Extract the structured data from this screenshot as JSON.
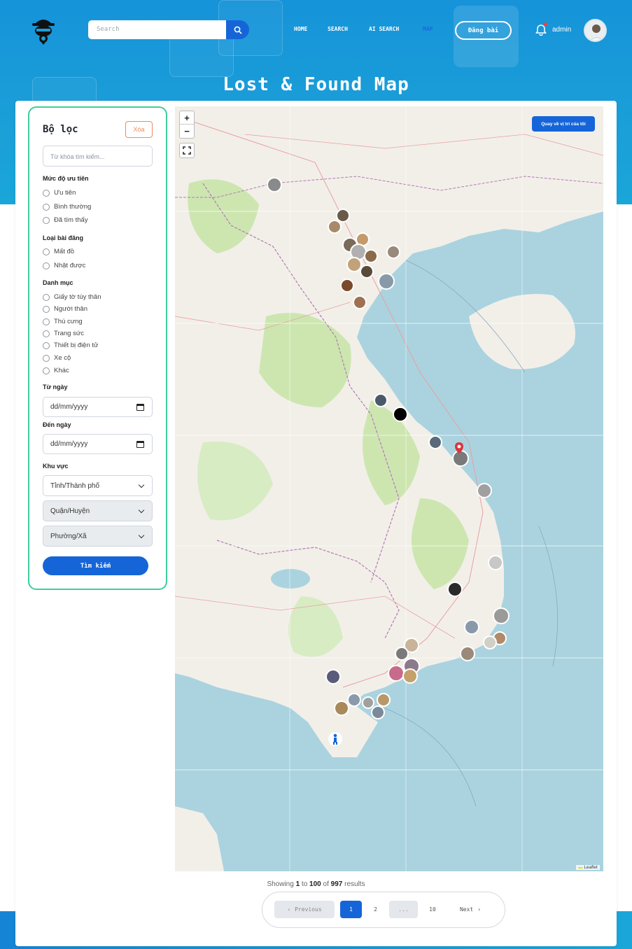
{
  "header": {
    "search_placeholder": "Search",
    "nav": [
      "HOME",
      "SEARCH",
      "AI SEARCH",
      "MAP"
    ],
    "active_nav": "MAP",
    "post_button": "Đăng bài",
    "user_name": "admin",
    "notification_dot_color": "#ff3b3b"
  },
  "page_title": "Lost & Found Map",
  "filter": {
    "title": "Bộ lọc",
    "clear_label": "Xóa",
    "keyword_placeholder": "Từ khóa tìm kiếm...",
    "priority": {
      "label": "Mức độ ưu tiên",
      "options": [
        "Ưu tiên",
        "Bình thường",
        "Đã tìm thấy"
      ]
    },
    "post_type": {
      "label": "Loại bài đăng",
      "options": [
        "Mất đồ",
        "Nhặt được"
      ]
    },
    "category": {
      "label": "Danh mục",
      "options": [
        "Giấy tờ tùy thân",
        "Người thân",
        "Thú cưng",
        "Trang sức",
        "Thiết bị điện tử",
        "Xe cộ",
        "Khác"
      ]
    },
    "from_date": {
      "label": "Từ ngày",
      "value": "dd/mm/yyyy"
    },
    "to_date": {
      "label": "Đến ngày",
      "value": "dd/mm/yyyy"
    },
    "area": {
      "label": "Khu vực",
      "province": "Tỉnh/Thành phố",
      "district": "Quận/Huyện",
      "ward": "Phường/Xã"
    },
    "submit_label": "Tìm kiếm"
  },
  "map": {
    "zoom_in": "+",
    "zoom_out": "−",
    "locate_label": "Quay về vị trí của tôi",
    "attribution": "Leaflet",
    "colors": {
      "sea": "#aad3df",
      "land": "#f2efe9",
      "forest": "#cde6b0",
      "border": "#b37ab4"
    }
  },
  "pagination": {
    "showing_prefix": "Showing",
    "from": "1",
    "to_word": "to",
    "to": "100",
    "of_word": "of",
    "total": "997",
    "suffix": "results",
    "previous": "Previous",
    "pages": [
      "1",
      "2",
      "...",
      "10"
    ],
    "current": "1",
    "next": "Next"
  },
  "accent_color": "#1565d8"
}
